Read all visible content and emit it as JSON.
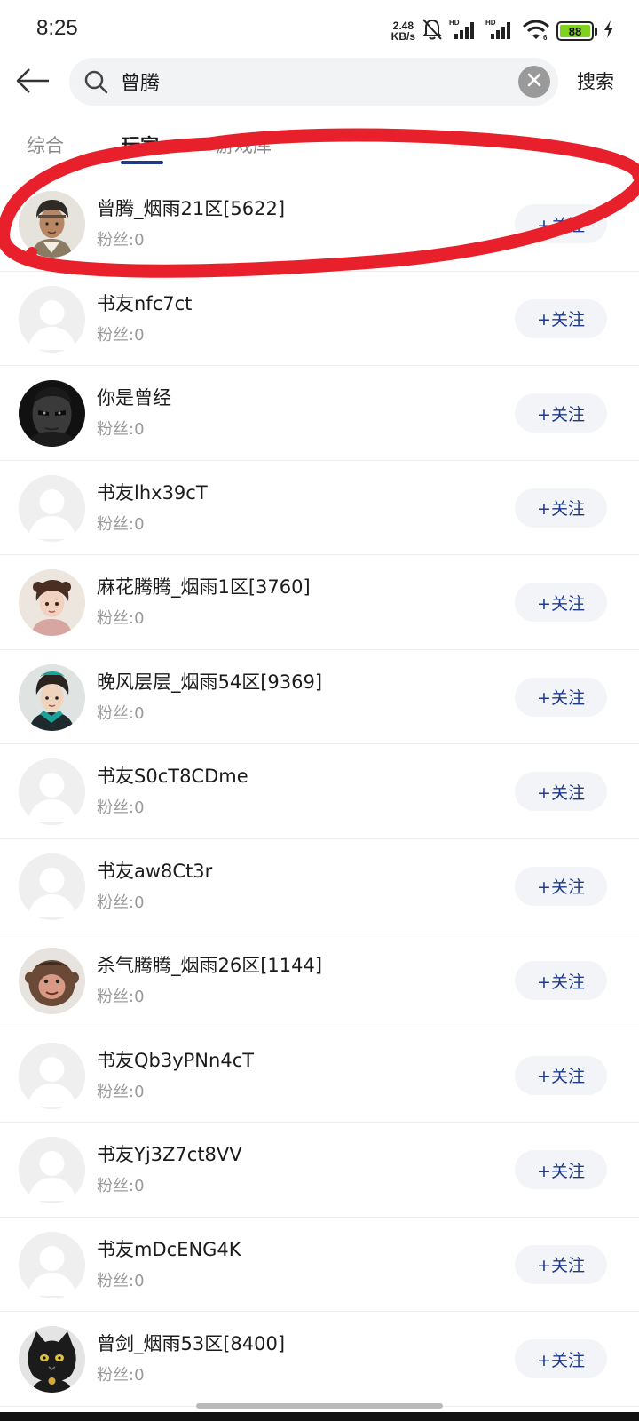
{
  "status_bar": {
    "time": "8:25",
    "net_speed_value": "2.48",
    "net_speed_unit": "KB/s",
    "hd1": "HD",
    "hd2": "HD",
    "wifi_label": "6",
    "battery_level": "88",
    "icons": [
      "bell-off-icon",
      "signal-icon",
      "signal-icon",
      "wifi-icon",
      "battery-icon",
      "charging-icon"
    ]
  },
  "search": {
    "query": "曾腾",
    "submit_label": "搜索",
    "icons": [
      "back-arrow-icon",
      "search-icon",
      "clear-icon"
    ]
  },
  "tabs": [
    {
      "label": "综合",
      "active": false
    },
    {
      "label": "玩家",
      "active": true
    },
    {
      "label": "游戏库",
      "active": false
    }
  ],
  "fans_label": "粉丝:",
  "follow_label": "+关注",
  "users": [
    {
      "name": "曾腾_烟雨21区[5622]",
      "fans": "0",
      "avatar": "game-character-male"
    },
    {
      "name": "书友nfc7ct",
      "fans": "0",
      "avatar": "default"
    },
    {
      "name": "你是曾经",
      "fans": "0",
      "avatar": "dark-portrait"
    },
    {
      "name": "书友lhx39cT",
      "fans": "0",
      "avatar": "default"
    },
    {
      "name": "麻花腾腾_烟雨1区[3760]",
      "fans": "0",
      "avatar": "game-character-female"
    },
    {
      "name": "晚风层层_烟雨54区[9369]",
      "fans": "0",
      "avatar": "game-character-teal"
    },
    {
      "name": "书友S0cT8CDme",
      "fans": "0",
      "avatar": "default"
    },
    {
      "name": "书友aw8Ct3r",
      "fans": "0",
      "avatar": "default"
    },
    {
      "name": "杀气腾腾_烟雨26区[1144]",
      "fans": "0",
      "avatar": "monkey"
    },
    {
      "name": "书友Qb3yPNn4cT",
      "fans": "0",
      "avatar": "default"
    },
    {
      "name": "书友Yj3Z7ct8VV",
      "fans": "0",
      "avatar": "default"
    },
    {
      "name": "书友mDcENG4K",
      "fans": "0",
      "avatar": "default"
    },
    {
      "name": "曾剑_烟雨53区[8400]",
      "fans": "0",
      "avatar": "black-cat"
    }
  ],
  "colors": {
    "accent": "#1f3a8a",
    "annotation": "#e8202c",
    "battery": "#7ed321"
  }
}
